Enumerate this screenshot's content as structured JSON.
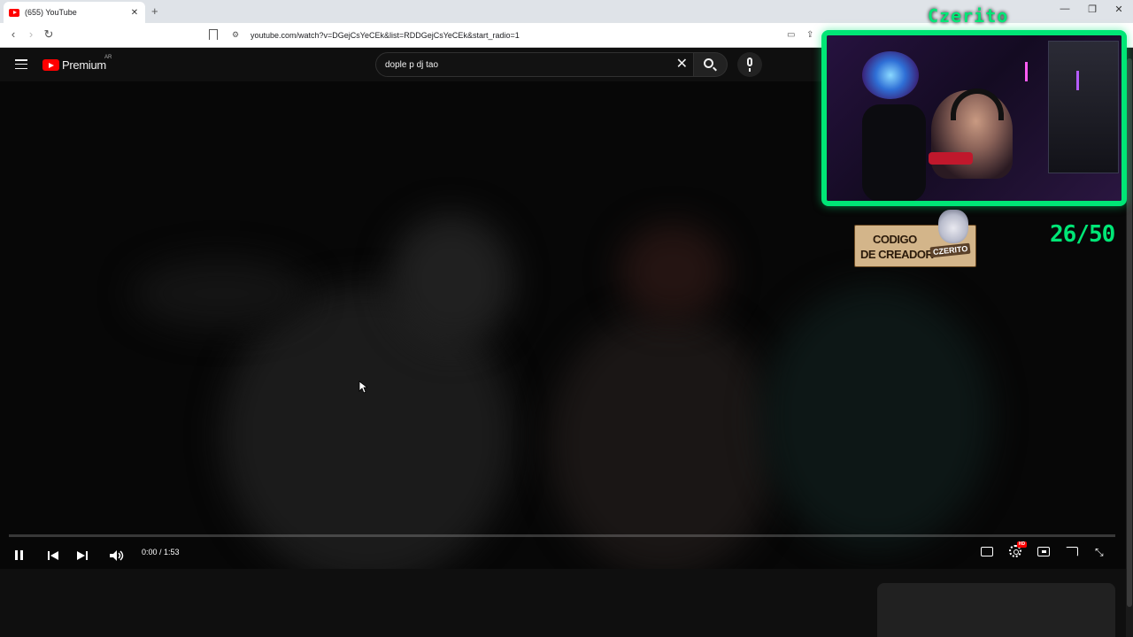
{
  "browser": {
    "tab_title": "(655) YouTube",
    "tab_close": "✕",
    "new_tab": "+",
    "url": "youtube.com/watch?v=DGejCsYeCEk&list=RDDGejCsYeCEk&start_radio=1",
    "window_controls": {
      "minimize": "—",
      "restore": "❐",
      "close": "✕"
    }
  },
  "youtube": {
    "logo_text": "Premium",
    "region": "AR",
    "search_query": "dople p dj tao",
    "clear_symbol": "✕"
  },
  "player": {
    "current_time": "0:00",
    "duration": "1:53",
    "time_display": "0:00 / 1:53",
    "progress": 0.0,
    "quality_badge": "HD"
  },
  "overlay": {
    "streamer_name": "Czerito",
    "creator_line1": "CODIGO",
    "creator_line2": "DE CREADOR",
    "creator_tag": "CZERITO",
    "counter": "26/50"
  },
  "colors": {
    "accent_green": "#00e676",
    "youtube_red": "#ff0000"
  }
}
